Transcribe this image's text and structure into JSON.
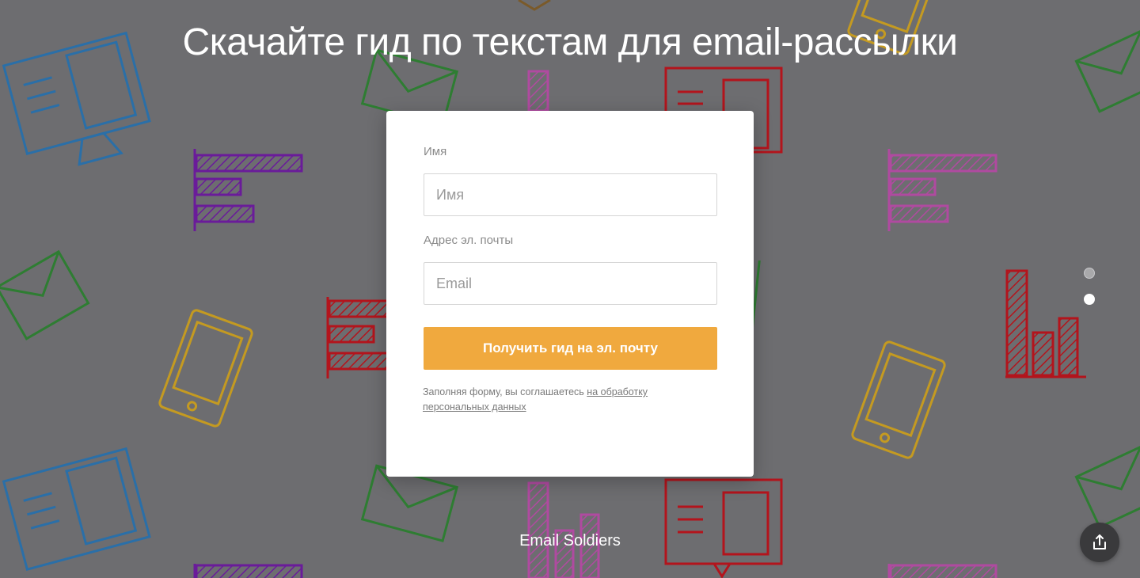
{
  "page": {
    "title": "Скачайте гид по текстам для email-рассылки",
    "footer_brand": "Email Soldiers"
  },
  "form": {
    "name_label": "Имя",
    "name_placeholder": "Имя",
    "email_label": "Адрес эл. почты",
    "email_placeholder": "Email",
    "submit_label": "Получить гид на эл. почту",
    "consent_text": "Заполняя форму, вы соглашаетесь ",
    "consent_link": "на обработку персональных данных"
  },
  "slide_dots": {
    "count": 2,
    "active_index": 1
  },
  "colors": {
    "background": "#6d6d70",
    "accent_button": "#f0a93e",
    "icon_blue": "#2a6fa8",
    "icon_green": "#2e7d32",
    "icon_purple": "#6a1b9a",
    "icon_red": "#b3141c",
    "icon_yellow": "#c49a21",
    "icon_pink": "#b04aa0"
  },
  "icons": {
    "share": "share-upload-icon",
    "pattern": [
      "monitor-icon",
      "envelope-icon",
      "bar-chart-icon",
      "phone-icon",
      "document-icon"
    ]
  }
}
